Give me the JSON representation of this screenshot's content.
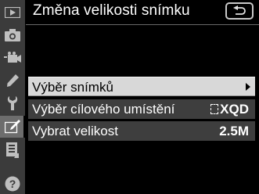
{
  "header": {
    "title": "Změna velikosti snímku"
  },
  "sidebar": {
    "tabs": [
      {
        "icon": "playback-icon"
      },
      {
        "icon": "camera-icon"
      },
      {
        "icon": "movie-icon"
      },
      {
        "icon": "pencil-icon"
      },
      {
        "icon": "wrench-icon"
      },
      {
        "icon": "retouch-icon",
        "active": true
      },
      {
        "icon": "my-menu-icon"
      },
      {
        "icon": "help-icon"
      }
    ]
  },
  "menu": {
    "items": [
      {
        "label": "Výběr snímků",
        "value": "",
        "selected": true
      },
      {
        "label": "Výběr cílového umístění",
        "value": "XQD"
      },
      {
        "label": "Vybrat velikost",
        "value": "2.5M"
      }
    ]
  },
  "colors": {
    "selected_bg": "#d8d8d8",
    "row_bg": "#3e3e3e",
    "sidebar_bg": "#3b3b3b",
    "active_tab_bg": "#6d6d6d"
  }
}
